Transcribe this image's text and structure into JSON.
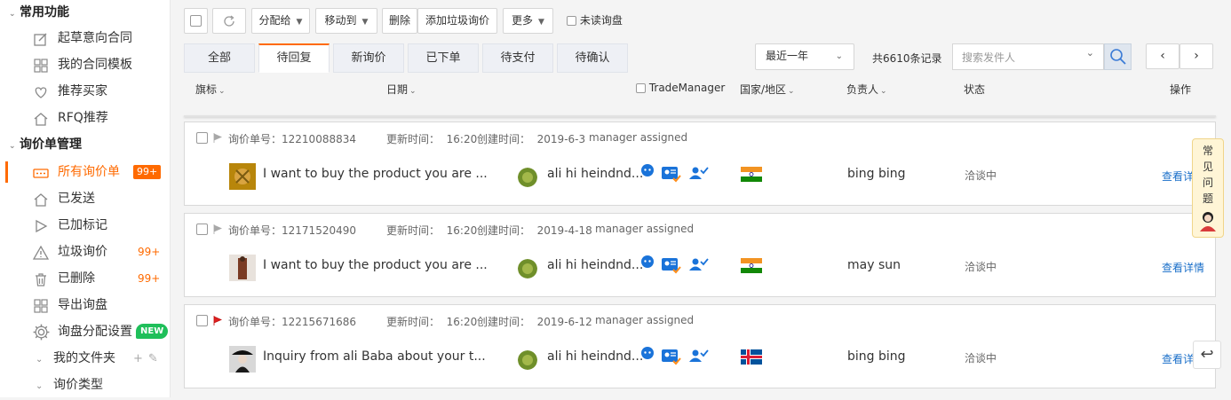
{
  "sidebar": {
    "section1": "常用功能",
    "items1": [
      "起草意向合同",
      "我的合同模板",
      "推荐买家",
      "RFQ推荐"
    ],
    "section2": "询价单管理",
    "items2": [
      "所有询价单",
      "已发送",
      "已加标记",
      "垃圾询价",
      "已删除",
      "导出询盘",
      "询盘分配设置"
    ],
    "badges": {
      "all": "99+",
      "spam": "99+",
      "deleted": "99+",
      "new": "NEW"
    },
    "folders": [
      "我的文件夹",
      "询价类型"
    ]
  },
  "toolbar": {
    "assign": "分配给",
    "move": "移动到",
    "delete": "删除",
    "add_spam": "添加垃圾询价",
    "more": "更多",
    "unread": "未读询盘"
  },
  "tabs": [
    "全部",
    "待回复",
    "新询价",
    "已下单",
    "待支付",
    "待确认"
  ],
  "filter": {
    "period": "最近一年",
    "total": "共6610条记录",
    "search_placeholder": "搜索发件人"
  },
  "columns": {
    "flag": "旗标",
    "date": "日期",
    "tm": "TradeManager",
    "country": "国家/地区",
    "owner": "负责人",
    "status": "状态",
    "action": "操作"
  },
  "inquiries": [
    {
      "order_label": "询价单号：",
      "order_no": "12210088834",
      "update_label": "更新时间：",
      "update_time": "16:20",
      "create_label": "创建时间：",
      "create_date": "2019-6-3",
      "note": "manager assigned",
      "subject": "I want to buy the product you are ...",
      "buyer": "ali hi heindnd...",
      "owner": "bing bing",
      "status": "洽谈中",
      "action": "查看详情",
      "flag_color": "#a8a8a8",
      "country_flag": "india"
    },
    {
      "order_label": "询价单号：",
      "order_no": "12171520490",
      "update_label": "更新时间：",
      "update_time": "16:20",
      "create_label": "创建时间：",
      "create_date": "2019-4-18",
      "note": "manager assigned",
      "subject": "I want to buy the product you are ...",
      "buyer": "ali hi heindnd...",
      "owner": "may sun",
      "status": "洽谈中",
      "action": "查看详情",
      "flag_color": "#a8a8a8",
      "country_flag": "india"
    },
    {
      "order_label": "询价单号：",
      "order_no": "12215671686",
      "update_label": "更新时间：",
      "update_time": "16:20",
      "create_label": "创建时间：",
      "create_date": "2019-6-12",
      "note": "manager assigned",
      "subject": "Inquiry from ali Baba about your t...",
      "buyer": "ali hi heindnd...",
      "owner": "bing bing",
      "status": "洽谈中",
      "action": "查看详情",
      "flag_color": "#e02020",
      "country_flag": "iceland"
    }
  ],
  "faq": [
    "常",
    "见",
    "问",
    "题"
  ],
  "accent_color": "#ff6a00"
}
